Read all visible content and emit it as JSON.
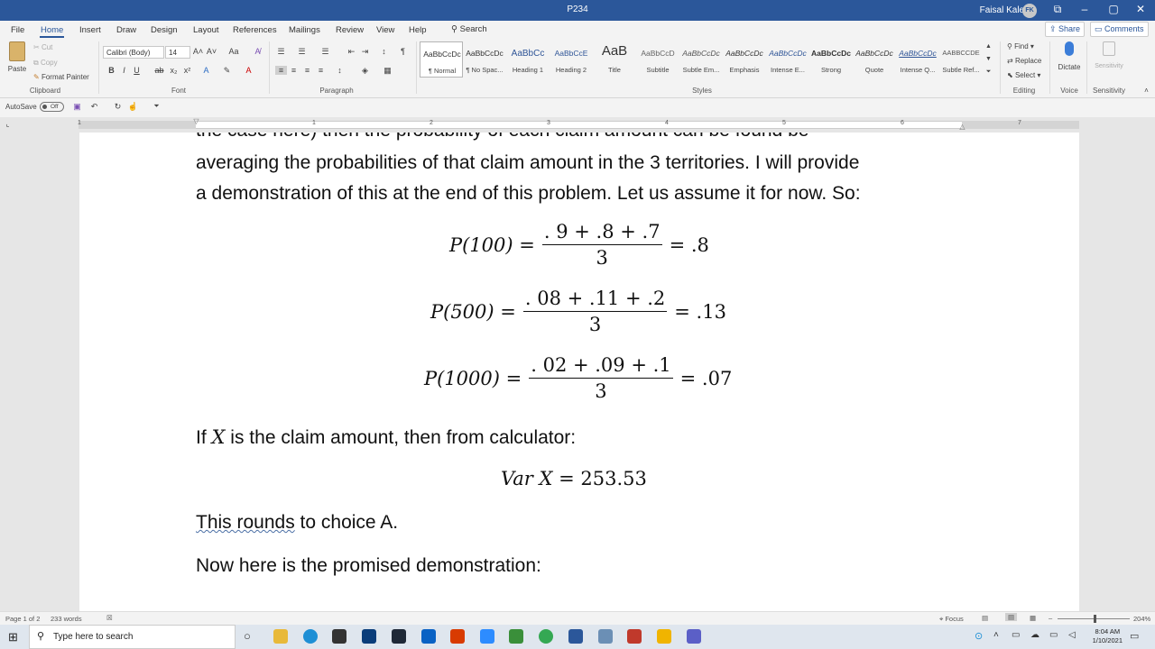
{
  "title_bar": {
    "doc_name": "P234",
    "user_name": "Faisal Kaleem",
    "user_initials": "FK",
    "btn_restore": "⧉",
    "btn_min": "–",
    "btn_max": "▢",
    "btn_close": "✕"
  },
  "tabs": [
    "File",
    "Home",
    "Insert",
    "Draw",
    "Design",
    "Layout",
    "References",
    "Mailings",
    "Review",
    "View",
    "Help"
  ],
  "search_label": "Search",
  "share_label": "Share",
  "comments_label": "Comments",
  "clipboard": {
    "paste": "Paste",
    "cut": "Cut",
    "copy": "Copy",
    "format_painter": "Format Painter",
    "group": "Clipboard"
  },
  "font": {
    "name": "Calibri (Body)",
    "size": "14",
    "group": "Font"
  },
  "paragraph": {
    "group": "Paragraph"
  },
  "styles": {
    "group": "Styles",
    "items": [
      {
        "preview": "AaBbCcDc",
        "name": "¶ Normal"
      },
      {
        "preview": "AaBbCcDc",
        "name": "¶ No Spac..."
      },
      {
        "preview": "AaBbCc",
        "name": "Heading 1"
      },
      {
        "preview": "AaBbCcE",
        "name": "Heading 2"
      },
      {
        "preview": "AaB",
        "name": "Title"
      },
      {
        "preview": "AaBbCcD",
        "name": "Subtitle"
      },
      {
        "preview": "AaBbCcDc",
        "name": "Subtle Em..."
      },
      {
        "preview": "AaBbCcDc",
        "name": "Emphasis"
      },
      {
        "preview": "AaBbCcDc",
        "name": "Intense E..."
      },
      {
        "preview": "AaBbCcDc",
        "name": "Strong"
      },
      {
        "preview": "AaBbCcDc",
        "name": "Quote"
      },
      {
        "preview": "AaBbCcDc",
        "name": "Intense Q..."
      },
      {
        "preview": "AABBCCDE",
        "name": "Subtle Ref..."
      }
    ]
  },
  "editing": {
    "find": "Find",
    "replace": "Replace",
    "select": "Select",
    "group": "Editing"
  },
  "voice": {
    "dictate": "Dictate",
    "group": "Voice"
  },
  "sensitivity": {
    "label": "Sensitivity",
    "group": "Sensitivity"
  },
  "qat": {
    "autosave": "AutoSave",
    "toggle": "Off"
  },
  "ruler_numbers": [
    "1",
    "1",
    "2",
    "3",
    "4",
    "5",
    "6",
    "7"
  ],
  "document": {
    "line_partial": "the case here) then the probability of each claim amount can be found be",
    "line1": "averaging the probabilities of that claim amount in the 3 territories.  I will provide",
    "line2": "a demonstration of this at the end of this problem.  Let us assume it for now.  So:",
    "eq1": {
      "lhs": "P(100) =",
      "num": ". 9 + .8 + .7",
      "den": "3",
      "rhs": "= .8"
    },
    "eq2": {
      "lhs": "P(500) =",
      "num": ". 08 + .11 + .2",
      "den": "3",
      "rhs": "= .13"
    },
    "eq3": {
      "lhs": "P(1000) =",
      "num": ". 02 + .09 + .1",
      "den": "3",
      "rhs": "= .07"
    },
    "para3_pre": "If ",
    "para3_var": "X",
    "para3_post": " is the claim amount, then from calculator:",
    "var_lhs": "Var X",
    "var_rhs": "= 253.53",
    "para4_u": "This rounds",
    "para4_rest": " to choice A.",
    "para5": "Now here is the promised demonstration:"
  },
  "status": {
    "page": "Page 1 of 2",
    "words": "233 words",
    "focus": "Focus",
    "zoom": "204%"
  },
  "taskbar": {
    "search": "Type here to search",
    "time": "8:04 AM",
    "date": "1/10/2021"
  }
}
